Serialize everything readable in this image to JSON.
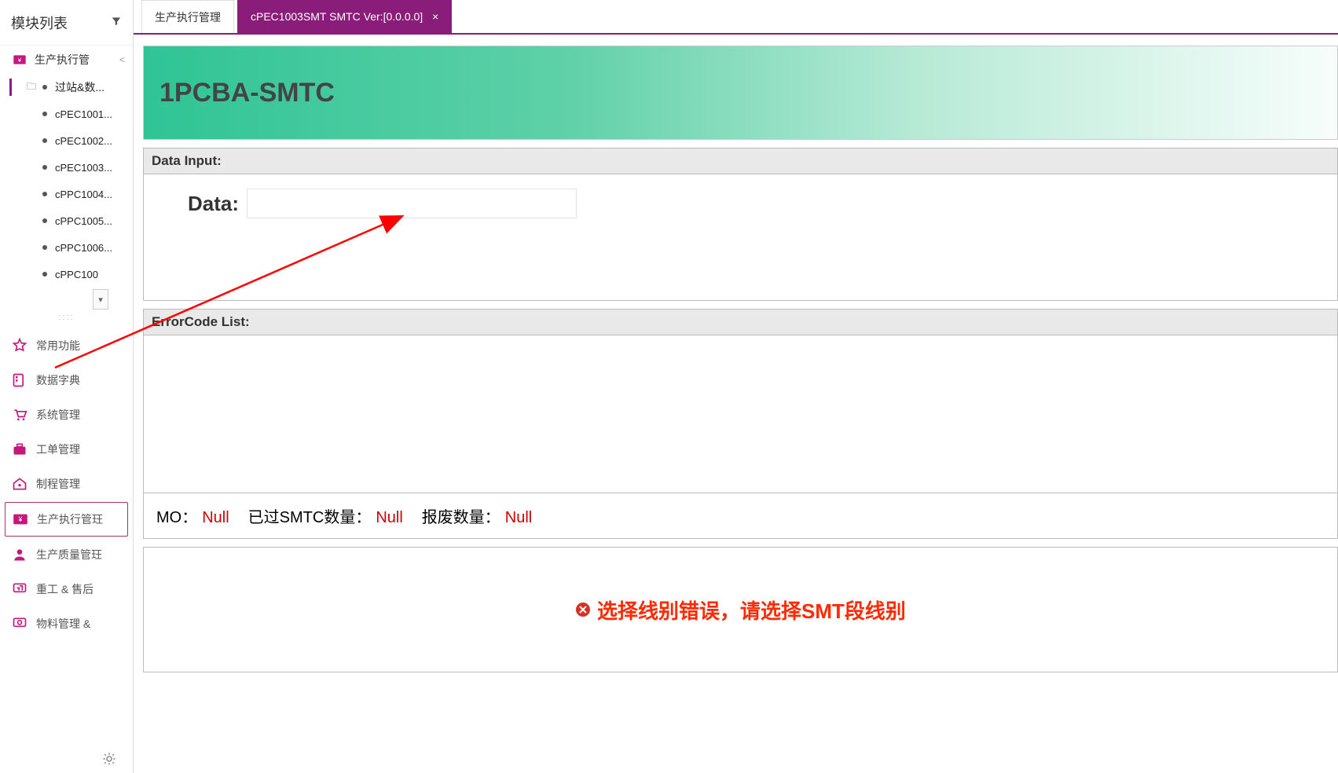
{
  "sidebar": {
    "title": "模块列表",
    "top_group": {
      "label": "生产执行管",
      "sub_label": "过站&数...",
      "leaves": [
        {
          "label": "cPEC1001..."
        },
        {
          "label": "cPEC1002..."
        },
        {
          "label": "cPEC1003..."
        },
        {
          "label": "cPPC1004..."
        },
        {
          "label": "cPPC1005..."
        },
        {
          "label": "cPPC1006..."
        },
        {
          "label": "cPPC100"
        }
      ]
    },
    "bottom": [
      {
        "label": "常用功能"
      },
      {
        "label": "数据字典"
      },
      {
        "label": "系统管理"
      },
      {
        "label": "工单管理"
      },
      {
        "label": "制程管理"
      },
      {
        "label": "生产执行管理",
        "selected": true,
        "display": "生产执行管玨"
      },
      {
        "label": "生产质量管玨"
      },
      {
        "label": "重工 & 售后"
      },
      {
        "label": "物料管理 &"
      }
    ]
  },
  "tabs": [
    {
      "label": "生产执行管理",
      "active": false,
      "closable": false
    },
    {
      "label": "cPEC1003SMT SMTC Ver:[0.0.0.0]",
      "active": true,
      "closable": true
    }
  ],
  "banner": {
    "title": "1PCBA-SMTC"
  },
  "data_input": {
    "section_title": "Data Input:",
    "field_label": "Data:",
    "field_value": ""
  },
  "error_list": {
    "section_title": "ErrorCode List:"
  },
  "mo_row": {
    "mo_label": "MO：",
    "mo_value": "Null",
    "smtc_label": "已过SMTC数量：",
    "smtc_value": "Null",
    "scrap_label": "报废数量：",
    "scrap_value": "Null"
  },
  "message": {
    "text": "选择线别错误，请选择SMT段线别"
  },
  "colors": {
    "brand": "#8a1d7a",
    "accent": "#c5187c",
    "error": "#ff2a00"
  }
}
